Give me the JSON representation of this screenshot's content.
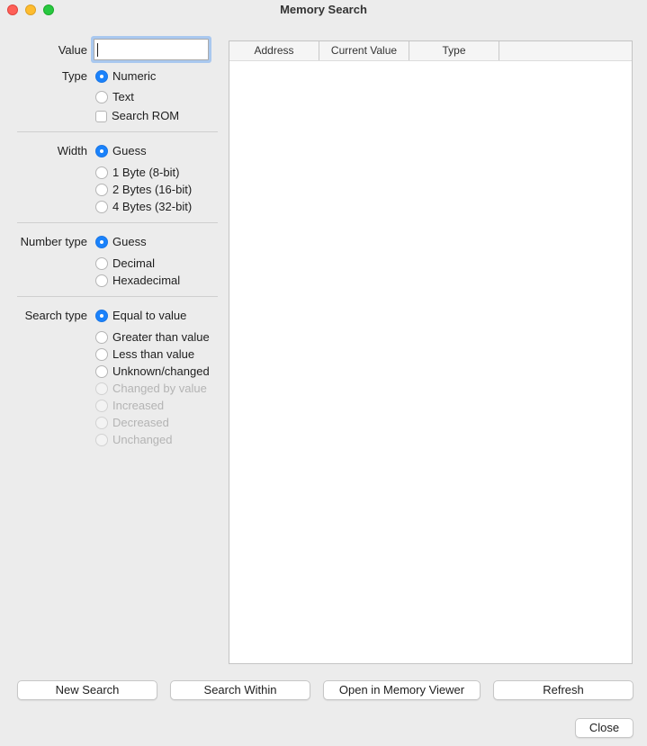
{
  "window": {
    "title": "Memory Search"
  },
  "form": {
    "value": {
      "label": "Value",
      "input_value": "",
      "placeholder": ""
    },
    "type": {
      "label": "Type",
      "options": [
        "Numeric",
        "Text"
      ],
      "selected": "Numeric",
      "search_rom_label": "Search ROM",
      "search_rom_checked": false
    },
    "width": {
      "label": "Width",
      "options": [
        "Guess",
        "1 Byte (8-bit)",
        "2 Bytes (16-bit)",
        "4 Bytes (32-bit)"
      ],
      "selected": "Guess"
    },
    "number_type": {
      "label": "Number type",
      "options": [
        "Guess",
        "Decimal",
        "Hexadecimal"
      ],
      "selected": "Guess"
    },
    "search_type": {
      "label": "Search type",
      "options": [
        "Equal to value",
        "Greater than value",
        "Less than value",
        "Unknown/changed",
        "Changed by value",
        "Increased",
        "Decreased",
        "Unchanged"
      ],
      "disabled_options": [
        "Changed by value",
        "Increased",
        "Decreased",
        "Unchanged"
      ],
      "selected": "Equal to value"
    }
  },
  "results_table": {
    "columns": [
      "Address",
      "Current Value",
      "Type"
    ],
    "rows": []
  },
  "buttons": {
    "new_search": "New Search",
    "search_within": "Search Within",
    "open_in_memory_viewer": "Open in Memory Viewer",
    "refresh": "Refresh",
    "close": "Close"
  }
}
